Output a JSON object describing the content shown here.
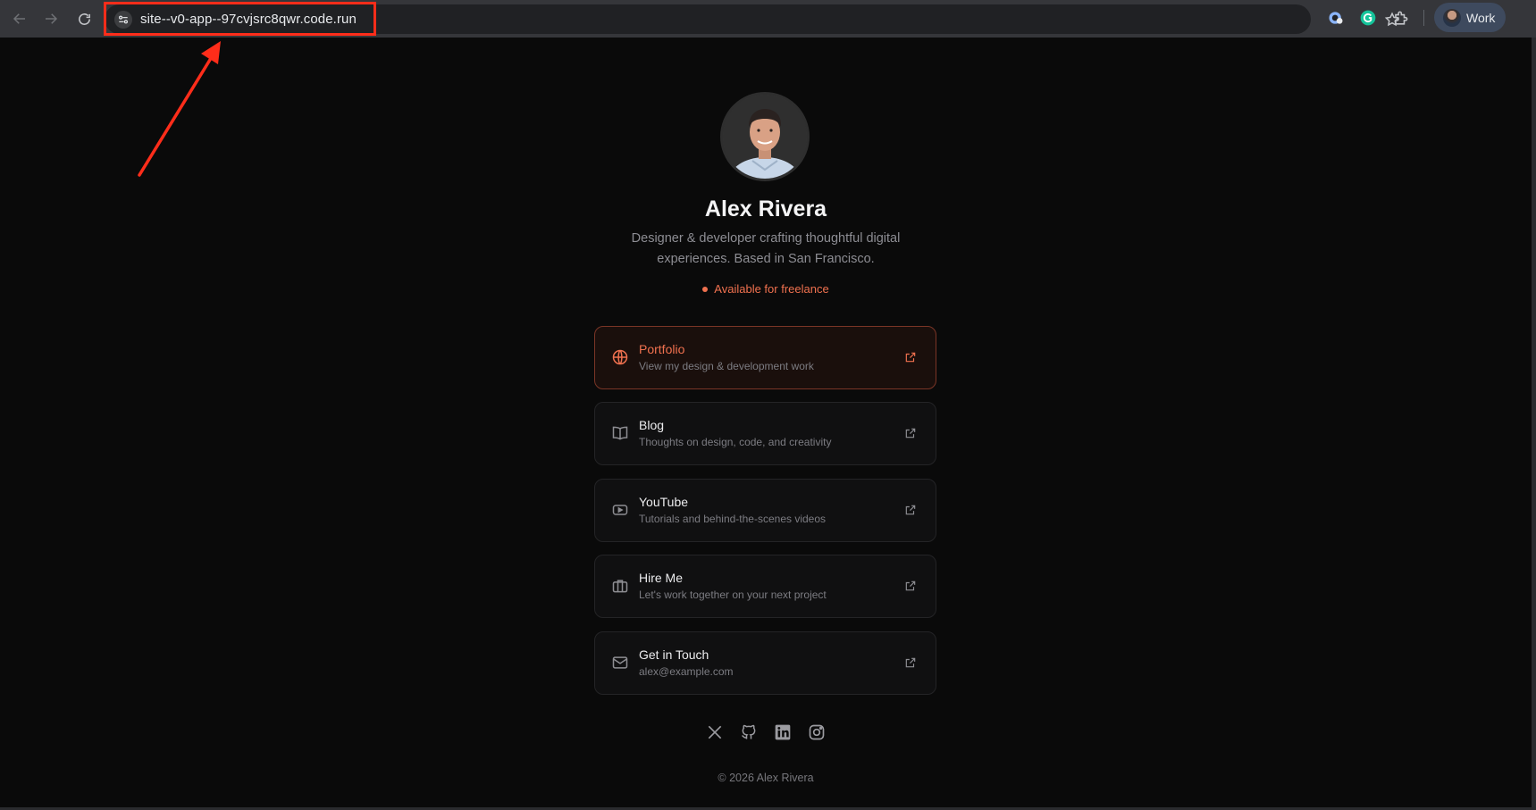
{
  "browser": {
    "url": "site--v0-app--97cvjsrc8qwr.code.run",
    "profile_label": "Work"
  },
  "profile": {
    "name": "Alex Rivera",
    "bio": "Designer & developer crafting thoughtful digital experiences. Based in San Francisco.",
    "status": "Available for freelance"
  },
  "links": [
    {
      "title": "Portfolio",
      "subtitle": "View my design & development work",
      "icon": "globe-icon"
    },
    {
      "title": "Blog",
      "subtitle": "Thoughts on design, code, and creativity",
      "icon": "book-icon"
    },
    {
      "title": "YouTube",
      "subtitle": "Tutorials and behind-the-scenes videos",
      "icon": "youtube-icon"
    },
    {
      "title": "Hire Me",
      "subtitle": "Let's work together on your next project",
      "icon": "briefcase-icon"
    },
    {
      "title": "Get in Touch",
      "subtitle": "alex@example.com",
      "icon": "mail-icon"
    }
  ],
  "socials": [
    "x-icon",
    "github-icon",
    "linkedin-icon",
    "instagram-icon"
  ],
  "footer": "© 2026 Alex Rivera",
  "colors": {
    "accent": "#f0714f",
    "background": "#0a0a0a",
    "annotation": "#ff2d1a"
  }
}
